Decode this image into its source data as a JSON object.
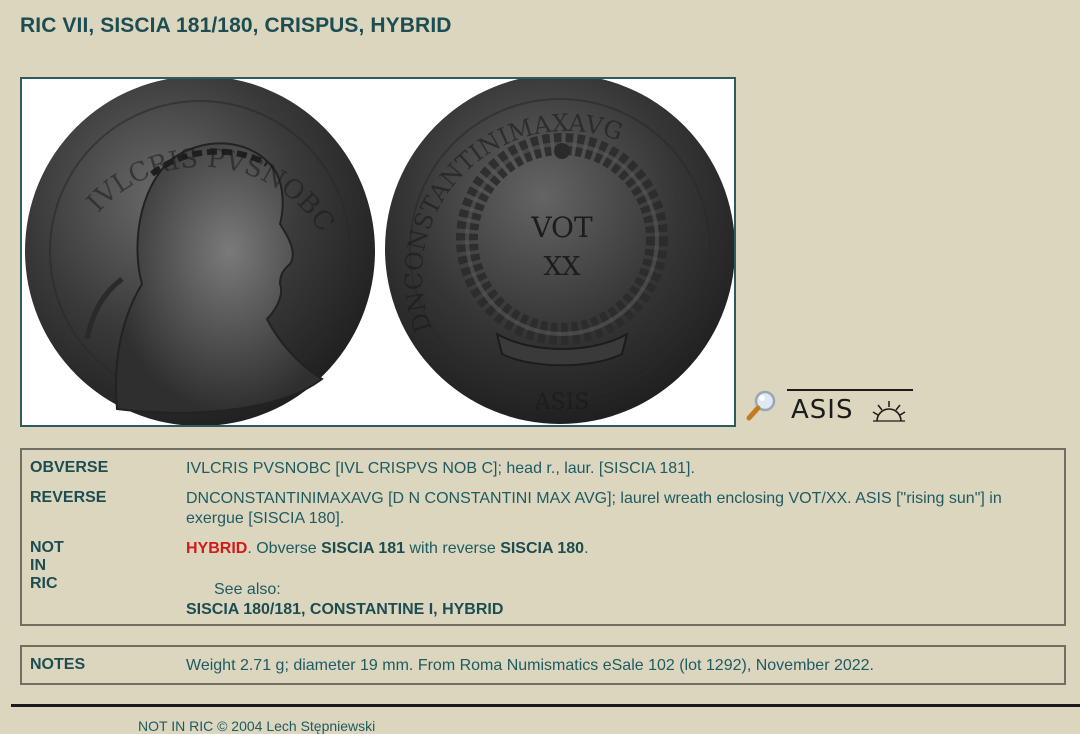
{
  "page": {
    "title": "RIC VII, SISCIA 181/180, CRISPUS, HYBRID"
  },
  "coin": {
    "obverse_legend_image": "IVLCRIS PVSNOBC",
    "reverse_legend_image": "DNCONSTANTINIMAXAVG",
    "reverse_center_top": "VOT",
    "reverse_center_bottom": "XX",
    "exergue_image": "ASIS"
  },
  "mint_mark": {
    "text": "ASIS",
    "icon": "rising-sun-icon",
    "zoom_icon": "magnifier-icon"
  },
  "description": {
    "obverse_label": "OBVERSE",
    "obverse_value": "IVLCRIS PVSNOBC [IVL CRISPVS NOB C]; head r., laur. [SISCIA 181].",
    "reverse_label": "REVERSE",
    "reverse_value": "DNCONSTANTINIMAXAVG [D N CONSTANTINI MAX AVG]; laurel wreath enclosing VOT/XX. ASIS [\"rising sun\"] in exergue [SISCIA 180].",
    "notinric_label": "NOT IN RIC",
    "hybrid_word": "HYBRID",
    "text1": ". Obverse ",
    "obverse_ref": "SISCIA 181",
    "text2": " with reverse ",
    "reverse_ref": "SISCIA 180",
    "text3": ".",
    "see_also_label": "See also:",
    "see_also_link": "SISCIA 180/181, CONSTANTINE I, HYBRID"
  },
  "notes": {
    "label": "NOTES",
    "value": "Weight 2.71 g; diameter 19 mm. From Roma Numismatics eSale 102 (lot 1292), November 2022."
  },
  "footer": {
    "text": "NOT IN RIC © 2004 Lech Stępniewski"
  },
  "colors": {
    "background": "#dbd6bd",
    "text": "#1e5b63",
    "heading": "#1d4d52",
    "hybrid_red": "#d11a1a"
  }
}
